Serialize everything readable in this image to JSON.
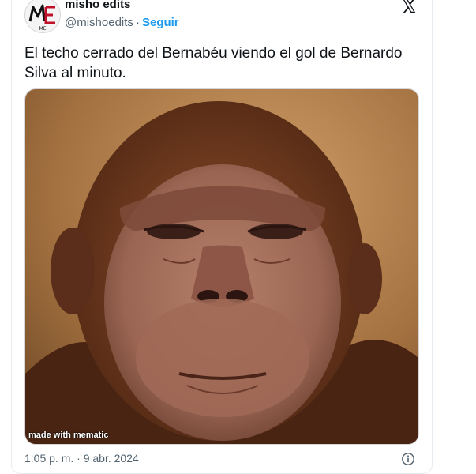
{
  "tweet": {
    "display_name": "misho edits",
    "handle": "@mishoedits",
    "separator": "·",
    "follow_label": "Seguir",
    "avatar_initials": "ME",
    "text": "El techo cerrado del Bernabéu viendo el gol de Bernardo Silva al minuto.",
    "timestamp": "1:05 p. m. · 9 abr. 2024",
    "media": {
      "icon": "ape-face-photo",
      "watermark": "made with mematic"
    }
  },
  "icons": {
    "platform": "x-logo-icon",
    "info": "info-icon"
  },
  "colors": {
    "link": "#1d9bf0",
    "text": "#0f1419",
    "secondary": "#536471",
    "avatar_accent": "#c0102a"
  }
}
